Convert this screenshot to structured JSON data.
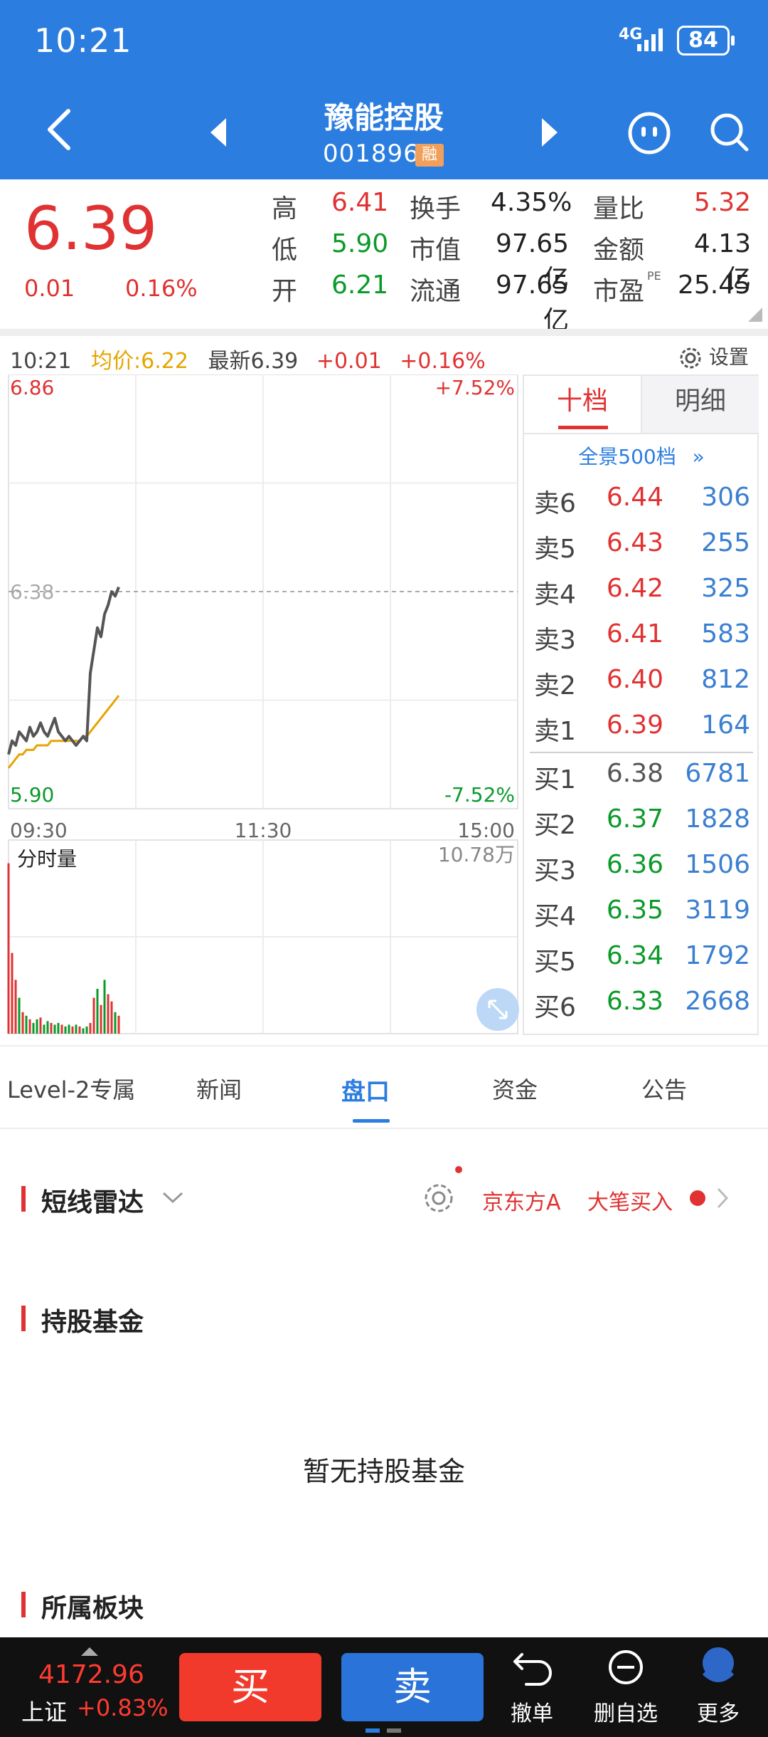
{
  "status": {
    "time": "10:21",
    "network": "4G",
    "battery": "84"
  },
  "header": {
    "title": "豫能控股",
    "code": "001896",
    "badge": "融"
  },
  "quote": {
    "price": "6.39",
    "change": "0.01",
    "change_pct": "0.16%",
    "fields": [
      {
        "label": "高",
        "value": "6.41",
        "color": "red"
      },
      {
        "label": "换手",
        "value": "4.35%",
        "color": "dark"
      },
      {
        "label": "量比",
        "value": "5.32",
        "color": "red"
      },
      {
        "label": "低",
        "value": "5.90",
        "color": "green"
      },
      {
        "label": "市值",
        "value": "97.65亿",
        "color": "dark"
      },
      {
        "label": "金额",
        "value": "4.13亿",
        "color": "dark"
      },
      {
        "label": "开",
        "value": "6.21",
        "color": "green"
      },
      {
        "label": "流通",
        "value": "97.65亿",
        "color": "dark"
      },
      {
        "label": "市盈",
        "sup": "PE",
        "value": "25.45",
        "color": "dark"
      }
    ]
  },
  "chart_info": {
    "time": "10:21",
    "avg": "均价:6.22",
    "latest": "最新6.39",
    "chg": "+0.01",
    "chg_pct": "+0.16%",
    "settings": "设置"
  },
  "chart_data": {
    "type": "line",
    "y_top": "6.86",
    "y_bottom": "5.90",
    "y_mid": "6.38",
    "pct_top": "+7.52%",
    "pct_bottom": "-7.52%",
    "x_ticks": [
      "09:30",
      "11:30",
      "15:00"
    ],
    "ylim": [
      5.9,
      6.86
    ],
    "price": [
      6.02,
      6.05,
      6.04,
      6.07,
      6.06,
      6.05,
      6.08,
      6.06,
      6.07,
      6.09,
      6.07,
      6.06,
      6.08,
      6.1,
      6.07,
      6.06,
      6.05,
      6.06,
      6.05,
      6.04,
      6.05,
      6.06,
      6.05,
      6.2,
      6.25,
      6.3,
      6.28,
      6.33,
      6.35,
      6.38,
      6.37,
      6.39
    ],
    "avg": [
      5.99,
      6.0,
      6.01,
      6.02,
      6.02,
      6.03,
      6.03,
      6.03,
      6.04,
      6.04,
      6.04,
      6.04,
      6.05,
      6.05,
      6.05,
      6.05,
      6.05,
      6.05,
      6.05,
      6.05,
      6.05,
      6.06,
      6.06,
      6.07,
      6.08,
      6.09,
      6.1,
      6.11,
      6.12,
      6.13,
      6.14,
      6.15
    ],
    "volume_label": "分时量",
    "volume_max": "10.78万",
    "volume": [
      0.95,
      0.45,
      0.3,
      0.2,
      0.12,
      0.1,
      0.08,
      0.06,
      0.08,
      0.09,
      0.05,
      0.07,
      0.06,
      0.05,
      0.06,
      0.05,
      0.04,
      0.05,
      0.04,
      0.05,
      0.04,
      0.03,
      0.04,
      0.06,
      0.2,
      0.25,
      0.16,
      0.3,
      0.22,
      0.18,
      0.12,
      0.1
    ],
    "volume_colors": [
      "red",
      "red",
      "red",
      "green",
      "red",
      "green",
      "red",
      "green",
      "green",
      "red",
      "green",
      "green",
      "red",
      "green",
      "green",
      "red",
      "green",
      "green",
      "red",
      "green",
      "red",
      "green",
      "green",
      "red",
      "red",
      "green",
      "red",
      "green",
      "red",
      "red",
      "green",
      "red"
    ]
  },
  "orderbook": {
    "tabs": [
      "十档",
      "明细"
    ],
    "full_link": "全景500档",
    "full_arrow": "»",
    "sells": [
      {
        "label": "卖6",
        "price": "6.44",
        "vol": "306"
      },
      {
        "label": "卖5",
        "price": "6.43",
        "vol": "255"
      },
      {
        "label": "卖4",
        "price": "6.42",
        "vol": "325"
      },
      {
        "label": "卖3",
        "price": "6.41",
        "vol": "583"
      },
      {
        "label": "卖2",
        "price": "6.40",
        "vol": "812"
      },
      {
        "label": "卖1",
        "price": "6.39",
        "vol": "164"
      }
    ],
    "buys": [
      {
        "label": "买1",
        "price": "6.38",
        "vol": "6781"
      },
      {
        "label": "买2",
        "price": "6.37",
        "vol": "1828"
      },
      {
        "label": "买3",
        "price": "6.36",
        "vol": "1506"
      },
      {
        "label": "买4",
        "price": "6.35",
        "vol": "3119"
      },
      {
        "label": "买5",
        "price": "6.34",
        "vol": "1792"
      },
      {
        "label": "买6",
        "price": "6.33",
        "vol": "2668"
      }
    ]
  },
  "tabs": [
    {
      "label": "Level-2专属"
    },
    {
      "label": "新闻"
    },
    {
      "label": "盘口"
    },
    {
      "label": "资金"
    },
    {
      "label": "公告"
    }
  ],
  "radar": {
    "title": "短线雷达",
    "stock": "京东方A",
    "signal": "大笔买入"
  },
  "funds": {
    "title": "持股基金",
    "empty": "暂无持股基金"
  },
  "sector": {
    "title": "所属板块"
  },
  "bottom": {
    "index_value": "4172.96",
    "index_name": "上证",
    "index_chg": "+0.83%",
    "buy": "买",
    "sell": "卖",
    "undo": "撤单",
    "remove_watch": "删自选",
    "more": "更多"
  }
}
